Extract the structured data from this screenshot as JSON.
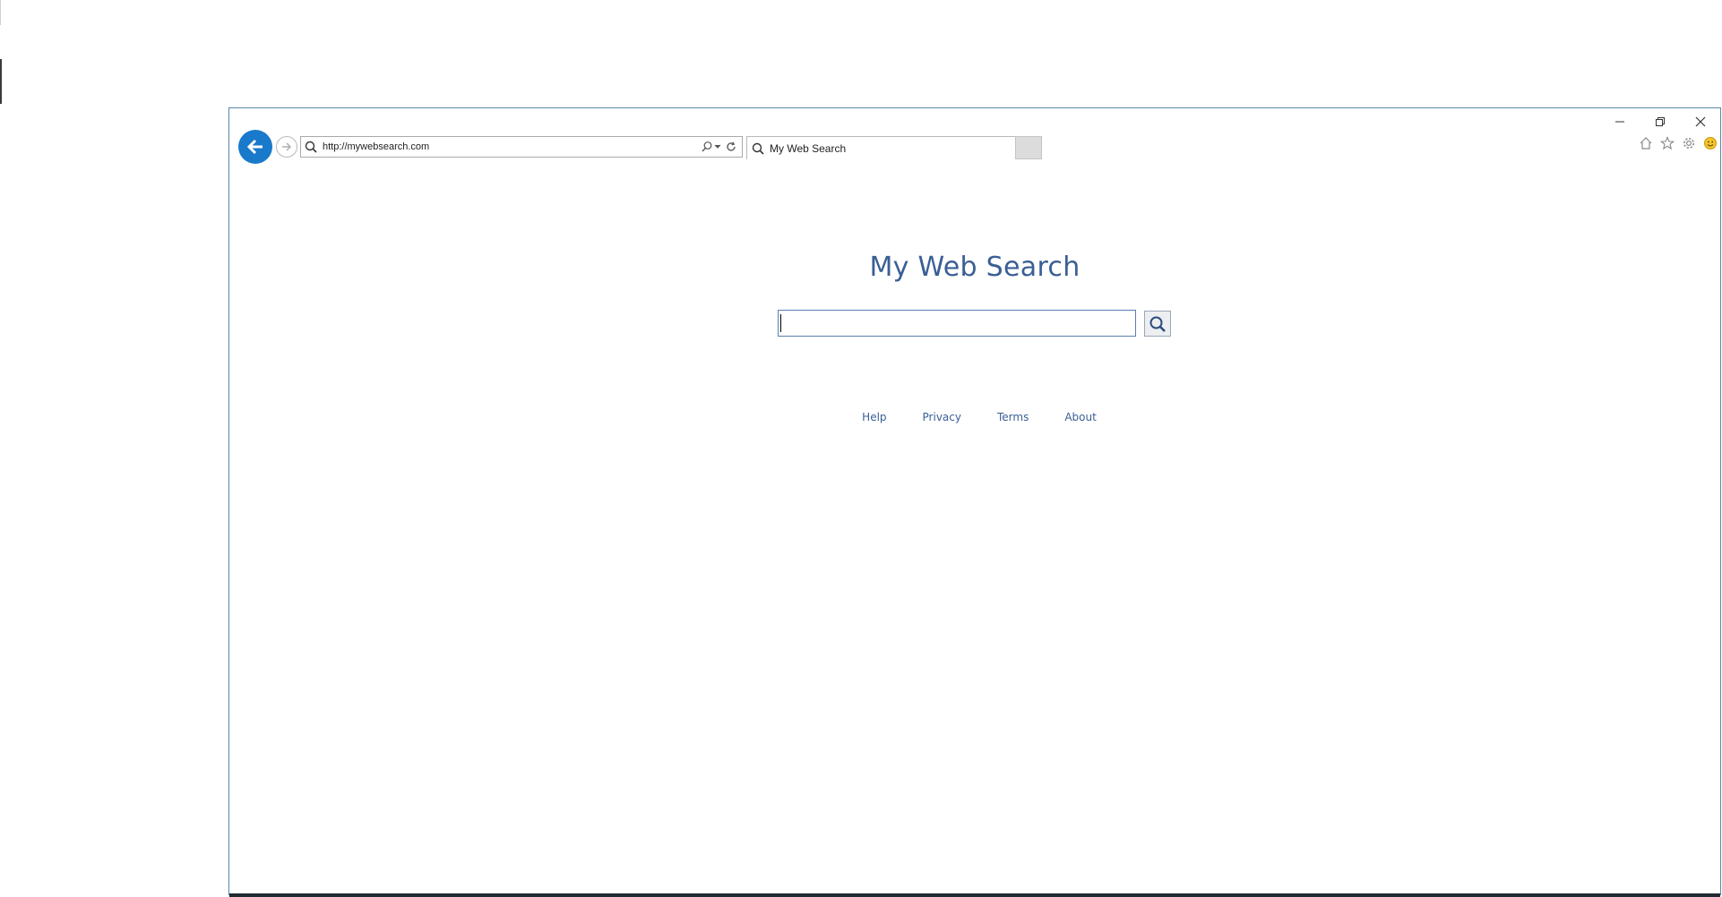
{
  "browser": {
    "address_url": "http://mywebsearch.com",
    "tab_title": "My Web Search",
    "caption": {
      "minimize": "minimize",
      "restore": "restore",
      "close": "close"
    },
    "icons": [
      "back-arrow-icon",
      "forward-arrow-icon",
      "search-icon",
      "refresh-icon",
      "home-icon",
      "favorites-star-icon",
      "settings-gear-icon",
      "feedback-smiley-icon"
    ]
  },
  "page": {
    "title": "My Web Search",
    "search_value": "",
    "footer_links": [
      "Help",
      "Privacy",
      "Terms",
      "About"
    ]
  },
  "colors": {
    "accent": "#1979ca",
    "link": "#3a5f95",
    "border": "#5b87a9"
  }
}
